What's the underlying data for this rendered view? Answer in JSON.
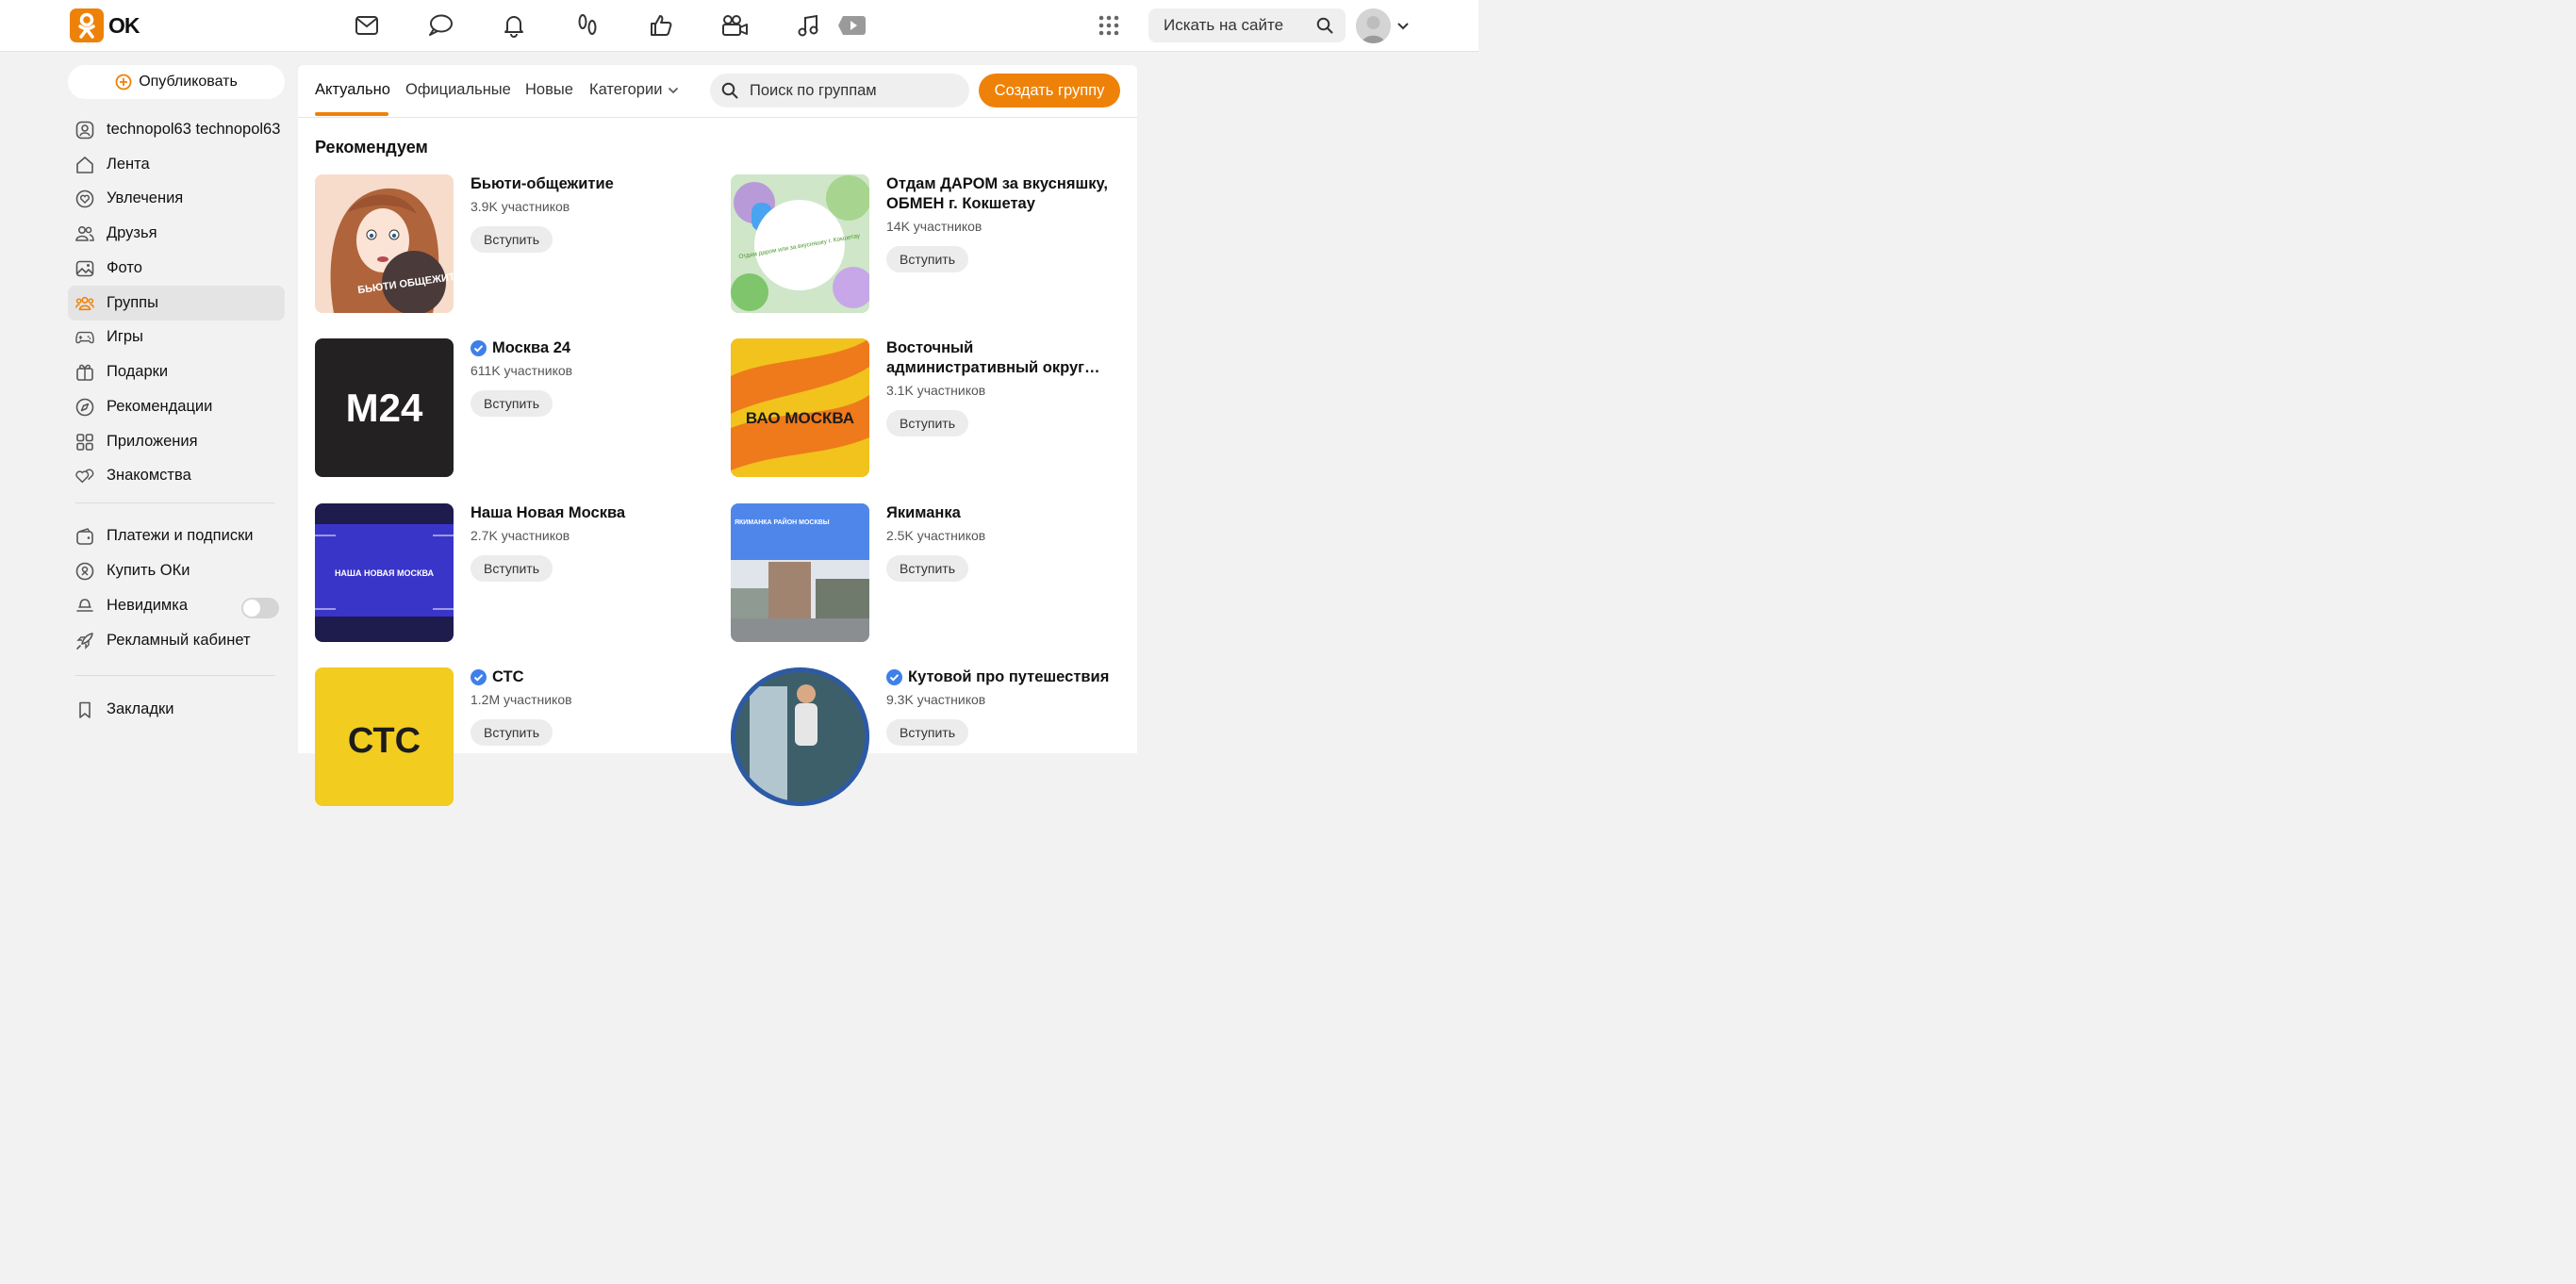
{
  "app": {
    "logo_text": "OK",
    "brand_color": "#ee8208"
  },
  "topbar": {
    "icons": [
      "mail-icon",
      "chat-icon",
      "bell-icon",
      "footprints-icon",
      "like-icon",
      "video-camera-icon",
      "music-icon",
      "video-play-icon",
      "apps-grid-icon"
    ],
    "search": {
      "placeholder": "Искать на сайте"
    }
  },
  "sidebar": {
    "publish_label": "Опубликовать",
    "items": [
      {
        "label": "technopol63 technopol63",
        "icon": "user-icon"
      },
      {
        "label": "Лента",
        "icon": "home-icon"
      },
      {
        "label": "Увлечения",
        "icon": "heart-icon"
      },
      {
        "label": "Друзья",
        "icon": "friends-icon"
      },
      {
        "label": "Фото",
        "icon": "photo-icon"
      },
      {
        "label": "Группы",
        "icon": "groups-icon",
        "active": true
      },
      {
        "label": "Игры",
        "icon": "gamepad-icon"
      },
      {
        "label": "Подарки",
        "icon": "gift-icon"
      },
      {
        "label": "Рекомендации",
        "icon": "compass-icon"
      },
      {
        "label": "Приложения",
        "icon": "apps-icon"
      },
      {
        "label": "Знакомства",
        "icon": "dating-icon"
      }
    ],
    "items2": [
      {
        "label": "Платежи и подписки",
        "icon": "wallet-icon"
      },
      {
        "label": "Купить ОКи",
        "icon": "coins-icon"
      },
      {
        "label": "Невидимка",
        "icon": "invisible-icon",
        "toggle": false
      },
      {
        "label": "Рекламный кабинет",
        "icon": "rocket-icon"
      }
    ],
    "items3": [
      {
        "label": "Закладки",
        "icon": "bookmark-icon"
      }
    ]
  },
  "main": {
    "tabs": [
      {
        "label": "Актуально",
        "active": true
      },
      {
        "label": "Официальные"
      },
      {
        "label": "Новые"
      },
      {
        "label": "Категории"
      }
    ],
    "search_placeholder": "Поиск по группам",
    "create_label": "Создать группу",
    "section_title": "Рекомендуем",
    "join_label": "Вступить",
    "groups": [
      {
        "name": "Бьюти-общежитие",
        "count": "3.9K участников",
        "verified": false,
        "thumb_text": "БЬЮТИ ОБЩЕЖИТИЕ"
      },
      {
        "name": "Отдам ДАРОМ за вкусняшку, ОБМЕН г. Кокшетау",
        "count": "14K участников",
        "verified": false,
        "thumb_text": "Отдам даром или за вкусняшку г. Кокшетау"
      },
      {
        "name": "Москва 24",
        "count": "611K участников",
        "verified": true,
        "thumb_text": "M24"
      },
      {
        "name": "Восточный административный округ…",
        "count": "3.1K участников",
        "verified": false,
        "thumb_text": "ВАО МОСКВА"
      },
      {
        "name": "Наша Новая Москва",
        "count": "2.7K участников",
        "verified": false,
        "thumb_text": "НАША НОВАЯ МОСКВА"
      },
      {
        "name": "Якиманка",
        "count": "2.5K участников",
        "verified": false,
        "thumb_text": "ЯКИМАНКА РАЙОН МОСКВЫ"
      },
      {
        "name": "СТС",
        "count": "1.2M участников",
        "verified": true,
        "thumb_text": "СТС"
      },
      {
        "name": "Кутовой про путешествия",
        "count": "9.3K участников",
        "verified": true,
        "thumb_text": ""
      }
    ]
  }
}
